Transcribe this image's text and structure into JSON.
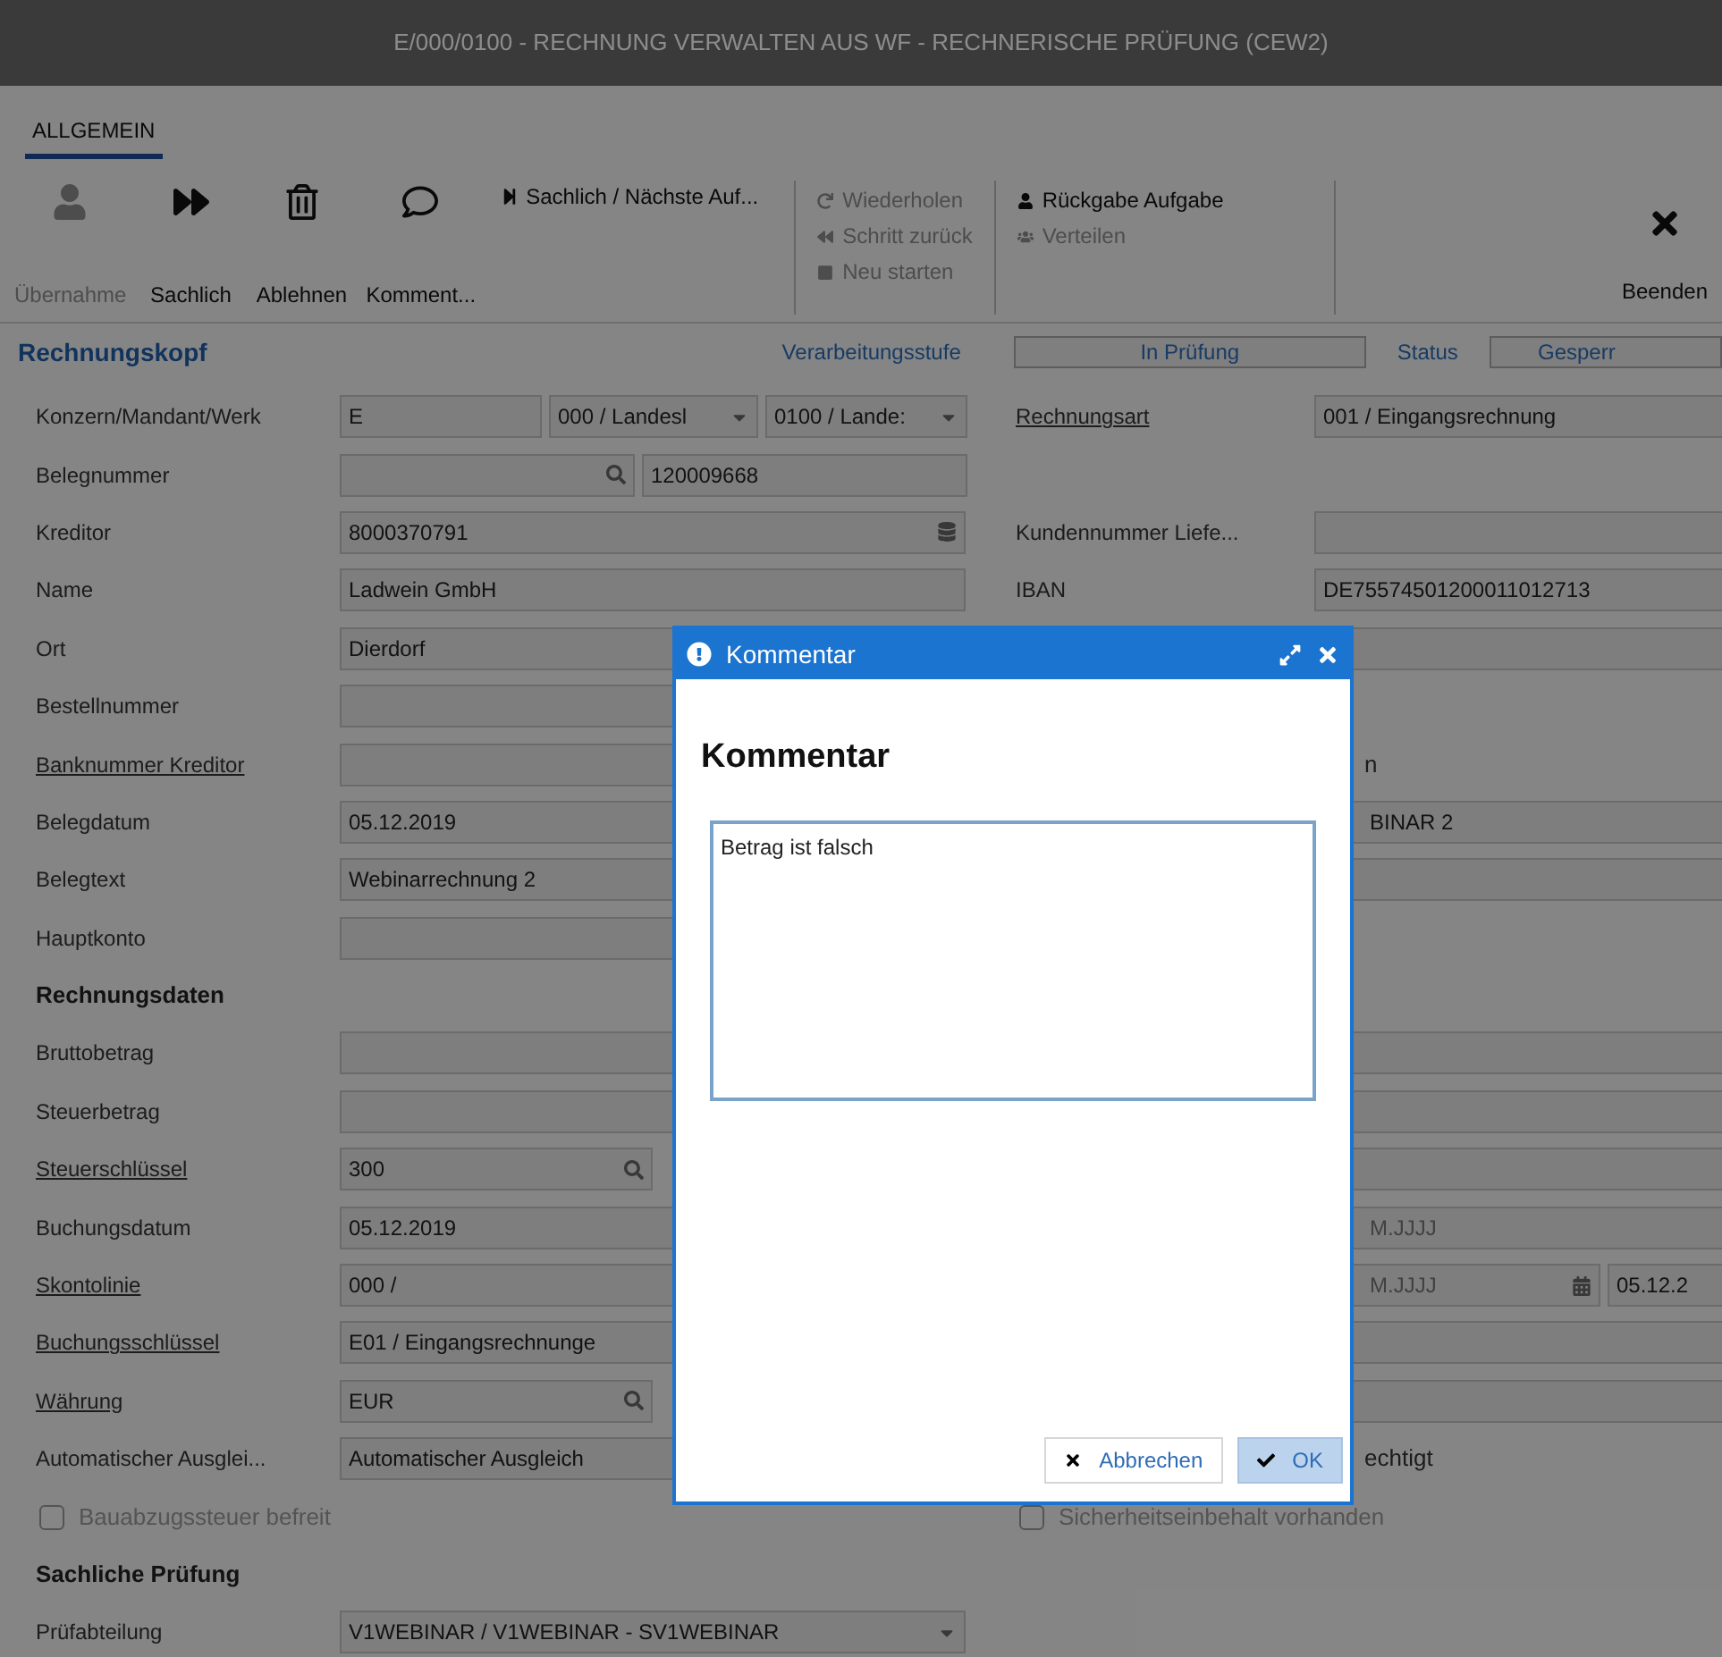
{
  "window": {
    "title": "E/000/0100 - RECHNUNG VERWALTEN AUS WF - RECHNERISCHE PRÜFUNG (CEW2)"
  },
  "tabs": [
    {
      "label": "ALLGEMEIN",
      "selected": true
    }
  ],
  "toolbar": {
    "large_buttons": [
      {
        "label": "Übernahme",
        "kind": "user",
        "disabled": true
      },
      {
        "label": "Sachlich",
        "kind": "forward",
        "disabled": false
      },
      {
        "label": "Ablehnen",
        "kind": "trash",
        "disabled": false
      },
      {
        "label": "Komment...",
        "kind": "comment",
        "disabled": false
      }
    ],
    "next_button": {
      "label": "Sachlich / Nächste Auf..."
    },
    "workflow_actions": [
      {
        "label": "Wiederholen",
        "kind": "redo",
        "disabled": true
      },
      {
        "label": "Schritt zurück",
        "kind": "back",
        "disabled": true
      },
      {
        "label": "Neu starten",
        "kind": "stop",
        "disabled": true
      }
    ],
    "task_actions": [
      {
        "label": "Rückgabe Aufgabe",
        "kind": "user",
        "disabled": false
      },
      {
        "label": "Verteilen",
        "kind": "users",
        "disabled": true
      }
    ],
    "close_button": {
      "label": "Beenden"
    }
  },
  "header": {
    "title": "Rechnungskopf",
    "stage_label": "Verarbeitungsstufe",
    "stage": "In Prüfung",
    "status_label": "Status",
    "status": "Gesperr"
  },
  "left_rows": [
    {
      "kind": "field",
      "label": "Konzern/Mandant/Werk",
      "link": false,
      "fields": [
        {
          "kind": "text",
          "value": "E"
        },
        {
          "kind": "dropdown",
          "value": "000 / Landesl"
        },
        {
          "kind": "dropdown",
          "value": "0100 / Lande:"
        }
      ]
    },
    {
      "kind": "field",
      "label": "Belegnummer",
      "link": false,
      "fields": [
        {
          "kind": "search"
        },
        {
          "kind": "text",
          "value": "120009668"
        }
      ]
    },
    {
      "kind": "field",
      "label": "Kreditor",
      "link": false,
      "fields": [
        {
          "kind": "list",
          "value": "8000370791"
        }
      ]
    },
    {
      "kind": "field",
      "label": "Name",
      "link": false,
      "fields": [
        {
          "kind": "text",
          "value": "Ladwein GmbH"
        }
      ]
    },
    {
      "kind": "field",
      "label": "Ort",
      "link": false,
      "fields": [
        {
          "kind": "text",
          "value": "Dierdorf"
        }
      ]
    },
    {
      "kind": "field",
      "label": "Bestellnummer",
      "link": false,
      "fields": [
        {
          "kind": "text"
        }
      ]
    },
    {
      "kind": "field",
      "label": "Banknummer Kreditor",
      "link": true,
      "fields": [
        {
          "kind": "text"
        }
      ]
    },
    {
      "kind": "field",
      "label": "Belegdatum",
      "link": false,
      "fields": [
        {
          "kind": "text",
          "value": "05.12.2019"
        }
      ]
    },
    {
      "kind": "field",
      "label": "Belegtext",
      "link": false,
      "fields": [
        {
          "kind": "text",
          "value": "Webinarrechnung 2"
        }
      ]
    },
    {
      "kind": "field",
      "label": "Hauptkonto",
      "link": false,
      "fields": [
        {
          "kind": "text"
        }
      ]
    },
    {
      "kind": "section",
      "label": "Rechnungsdaten"
    },
    {
      "kind": "field",
      "label": "Bruttobetrag",
      "link": false,
      "fields": [
        {
          "kind": "text"
        }
      ]
    },
    {
      "kind": "field",
      "label": "Steuerbetrag",
      "link": false,
      "fields": [
        {
          "kind": "text"
        }
      ]
    },
    {
      "kind": "field",
      "label": "Steuerschlüssel",
      "link": true,
      "fields": [
        {
          "kind": "search",
          "value": "300"
        }
      ]
    },
    {
      "kind": "field",
      "label": "Buchungsdatum",
      "link": false,
      "fields": [
        {
          "kind": "text",
          "value": "05.12.2019"
        }
      ]
    },
    {
      "kind": "field",
      "label": "Skontolinie",
      "link": true,
      "fields": [
        {
          "kind": "text",
          "value": "000 /"
        }
      ]
    },
    {
      "kind": "field",
      "label": "Buchungsschlüssel",
      "link": true,
      "fields": [
        {
          "kind": "text",
          "value": "E01 / Eingangsrechnunge"
        }
      ]
    },
    {
      "kind": "field",
      "label": "Währung",
      "link": true,
      "fields": [
        {
          "kind": "search",
          "value": "EUR"
        }
      ]
    },
    {
      "kind": "field",
      "label": "Automatischer Ausglei...",
      "link": false,
      "fields": [
        {
          "kind": "text",
          "value": "Automatischer Ausgleich"
        }
      ]
    },
    {
      "kind": "checkbox",
      "label": "Bauabzugssteuer befreit",
      "checked": false,
      "disabled": true
    },
    {
      "kind": "section",
      "label": "Sachliche Prüfung"
    },
    {
      "kind": "field",
      "label": "Prüfabteilung",
      "link": false,
      "fields": [
        {
          "kind": "dropdown",
          "value": "V1WEBINAR / V1WEBINAR - SV1WEBINAR"
        }
      ]
    }
  ],
  "right_rows": [
    {
      "kind": "field",
      "label": "Rechnungsart",
      "link": true,
      "fields": [
        {
          "kind": "text",
          "value": "001 / Eingangsrechnung"
        }
      ]
    },
    {
      "kind": "blank"
    },
    {
      "kind": "field",
      "label": "Kundennummer Liefe...",
      "link": false,
      "fields": [
        {
          "kind": "text"
        }
      ]
    },
    {
      "kind": "field",
      "label": "IBAN",
      "link": false,
      "fields": [
        {
          "kind": "text",
          "value": "DE75574501200011012713"
        }
      ]
    },
    {
      "kind": "field",
      "fields": [
        {
          "kind": "text"
        }
      ]
    },
    {
      "kind": "blank"
    },
    {
      "kind": "label",
      "label": "n"
    },
    {
      "kind": "field",
      "fields": [
        {
          "kind": "text",
          "value": "BINAR 2"
        }
      ]
    },
    {
      "kind": "field",
      "fields": [
        {
          "kind": "text"
        }
      ]
    },
    {
      "kind": "blank"
    },
    {
      "kind": "blank"
    },
    {
      "kind": "field",
      "fields": [
        {
          "kind": "text"
        }
      ]
    },
    {
      "kind": "field",
      "fields": [
        {
          "kind": "text"
        }
      ]
    },
    {
      "kind": "field",
      "fields": [
        {
          "kind": "text"
        }
      ]
    },
    {
      "kind": "field",
      "fields": [
        {
          "kind": "text",
          "placeholder": "M.JJJJ"
        }
      ]
    },
    {
      "kind": "field",
      "fields": [
        {
          "kind": "date",
          "placeholder": "M.JJJJ"
        },
        {
          "kind": "text",
          "value": "05.12.2"
        }
      ]
    },
    {
      "kind": "field",
      "fields": [
        {
          "kind": "text"
        }
      ]
    },
    {
      "kind": "field",
      "fields": [
        {
          "kind": "text"
        }
      ]
    },
    {
      "kind": "label",
      "label": "echtigt"
    },
    {
      "kind": "checkbox",
      "label": "Sicherheitseinbehalt vorhanden",
      "checked": false,
      "disabled": true
    }
  ],
  "dialog": {
    "title": "Kommentar",
    "heading": "Kommentar",
    "comment": "Betrag ist falsch",
    "buttons": [
      {
        "label": "Abbrechen",
        "kind": "cancel",
        "highlighted": false
      },
      {
        "label": "OK",
        "kind": "ok",
        "highlighted": true
      }
    ]
  }
}
